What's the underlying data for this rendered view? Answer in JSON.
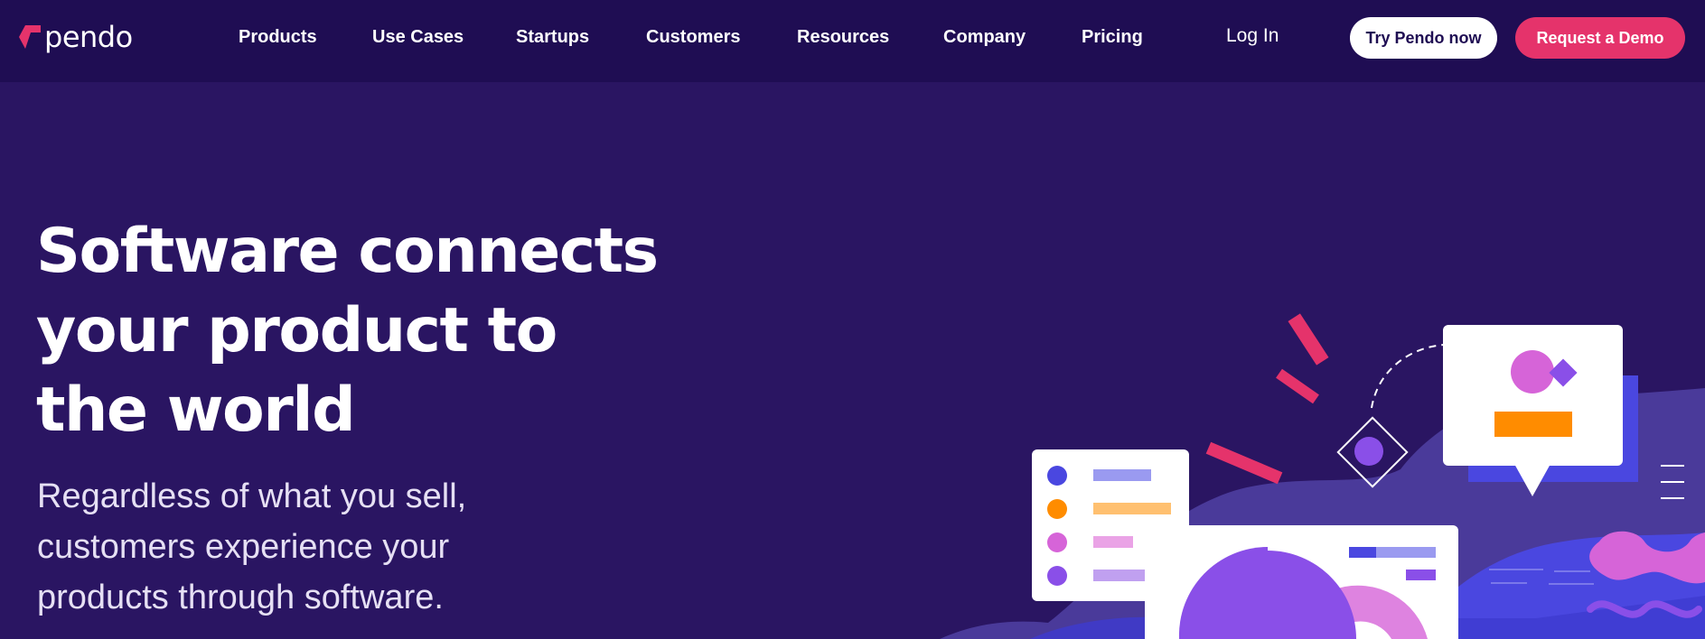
{
  "brand": {
    "name": "pendo"
  },
  "nav": {
    "links": [
      {
        "label": "Products"
      },
      {
        "label": "Use Cases"
      },
      {
        "label": "Startups"
      },
      {
        "label": "Customers"
      },
      {
        "label": "Resources"
      },
      {
        "label": "Company"
      },
      {
        "label": "Pricing"
      }
    ],
    "login": "Log In",
    "try_button": "Try Pendo now",
    "demo_button": "Request a Demo"
  },
  "hero": {
    "headline": [
      "Software connects",
      "your product to",
      "the world"
    ],
    "subtext": [
      "Regardless of what you sell,",
      "customers experience your",
      "products through software."
    ]
  },
  "colors": {
    "nav_bg": "#1f0d53",
    "page_bg": "#2a1562",
    "accent_pink": "#e5336b",
    "purple": "#8a4fe8",
    "orange": "#ff8c00",
    "blue": "#4a47e0"
  }
}
